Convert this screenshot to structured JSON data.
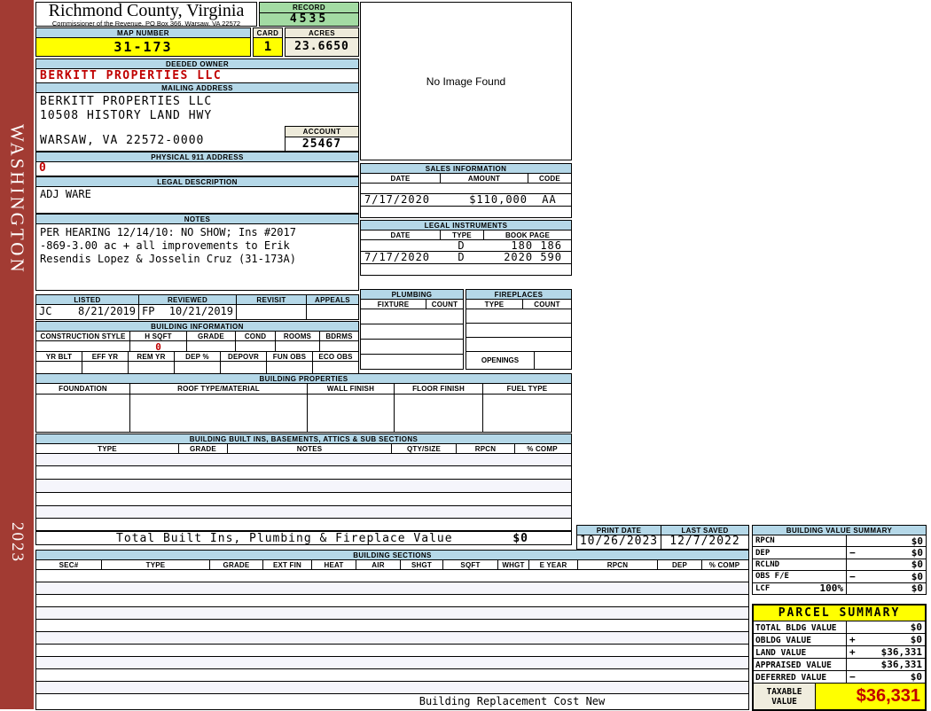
{
  "county": {
    "title": "Richmond County, Virginia",
    "subtitle": "Commissioner of the Revenue, PO Box 366, Warsaw, VA 22572"
  },
  "sidebar": {
    "district": "WASHINGTON",
    "year": "2023"
  },
  "record": {
    "label": "RECORD",
    "value": "4535"
  },
  "map": {
    "label": "MAP NUMBER",
    "value": "31-173"
  },
  "card": {
    "label": "CARD",
    "value": "1"
  },
  "acres": {
    "label": "ACRES",
    "value": "23.6650"
  },
  "deeded_owner": {
    "label": "DEEDED OWNER",
    "value": "BERKITT PROPERTIES LLC"
  },
  "mailing": {
    "label": "MAILING ADDRESS",
    "line1": "BERKITT PROPERTIES LLC",
    "line2": "10508 HISTORY LAND HWY",
    "line3": "WARSAW, VA 22572-0000"
  },
  "account": {
    "label": "ACCOUNT",
    "value": "25467"
  },
  "physical": {
    "label": "PHYSICAL 911 ADDRESS",
    "value": "0"
  },
  "legal_description": {
    "label": "LEGAL DESCRIPTION",
    "value": "ADJ WARE"
  },
  "notes": {
    "label": "NOTES",
    "line1": "PER HEARING 12/14/10: NO SHOW; Ins #2017",
    "line2": "-869-3.00 ac + all improvements to Erik",
    "line3": "Resendis Lopez & Josselin Cruz (31-173A)"
  },
  "image_box": {
    "text": "No Image Found"
  },
  "review": {
    "headers": [
      "LISTED",
      "REVIEWED",
      "REVISIT",
      "APPEALS"
    ],
    "listed_by": "JC",
    "listed_date": "8/21/2019",
    "reviewed_by": "FP",
    "reviewed_date": "10/21/2019"
  },
  "building_information": {
    "title": "BUILDING INFORMATION",
    "row1_headers": [
      "CONSTRUCTION STYLE",
      "H SQFT",
      "GRADE",
      "COND",
      "ROOMS",
      "BDRMS"
    ],
    "h_sqft_value": "0",
    "row2_headers": [
      "YR BLT",
      "EFF YR",
      "REM YR",
      "DEP %",
      "DEPOVR",
      "FUN OBS",
      "ECO OBS"
    ]
  },
  "sales_information": {
    "title": "SALES INFORMATION",
    "headers": [
      "DATE",
      "AMOUNT",
      "CODE"
    ],
    "rows": [
      [
        "",
        "",
        ""
      ],
      [
        "7/17/2020",
        "$110,000",
        "AA"
      ],
      [
        "",
        "",
        ""
      ]
    ]
  },
  "legal_instruments": {
    "title": "LEGAL INSTRUMENTS",
    "headers": [
      "DATE",
      "TYPE",
      "BOOK PAGE"
    ],
    "rows": [
      [
        "",
        "D",
        "180 186"
      ],
      [
        "7/17/2020",
        "D",
        "2020 590"
      ],
      [
        "",
        "",
        ""
      ]
    ]
  },
  "plumbing": {
    "title": "PLUMBING",
    "headers": [
      "FIXTURE",
      "COUNT"
    ]
  },
  "fireplaces": {
    "title": "FIREPLACES",
    "headers": [
      "TYPE",
      "COUNT"
    ],
    "openings_label": "OPENINGS"
  },
  "building_properties": {
    "title": "BUILDING PROPERTIES",
    "headers": [
      "FOUNDATION",
      "ROOF TYPE/MATERIAL",
      "WALL FINISH",
      "FLOOR FINISH",
      "FUEL TYPE"
    ]
  },
  "built_ins": {
    "title": "BUILDING BUILT INS, BASEMENTS, ATTICS & SUB SECTIONS",
    "headers": [
      "TYPE",
      "GRADE",
      "NOTES",
      "QTY/SIZE",
      "RPCN",
      "% COMP"
    ],
    "total_label": "Total Built Ins, Plumbing & Fireplace Value",
    "total_value": "$0"
  },
  "print_info": {
    "print_date_label": "PRINT DATE",
    "print_date": "10/26/2023",
    "last_saved_label": "LAST SAVED",
    "last_saved": "12/7/2022"
  },
  "building_value_summary": {
    "title": "BUILDING VALUE SUMMARY",
    "rows": [
      {
        "label": "RPCN",
        "sub": "",
        "op": "",
        "value": "$0"
      },
      {
        "label": "DEP",
        "sub": "",
        "op": "−",
        "value": "$0"
      },
      {
        "label": "RCLND",
        "sub": "",
        "op": "",
        "value": "$0"
      },
      {
        "label": "OBS F/E",
        "sub": "",
        "op": "−",
        "value": "$0"
      },
      {
        "label": "LCF",
        "sub": "100%",
        "op": "",
        "value": "$0"
      }
    ]
  },
  "building_sections": {
    "title": "BUILDING SECTIONS",
    "headers": [
      "SEC#",
      "TYPE",
      "GRADE",
      "EXT FIN",
      "HEAT",
      "AIR",
      "SHGT",
      "SQFT",
      "WHGT",
      "E YEAR",
      "RPCN",
      "DEP",
      "% COMP"
    ],
    "footer": "Building Replacement Cost New"
  },
  "parcel_summary": {
    "title": "PARCEL SUMMARY",
    "rows": [
      {
        "label": "TOTAL BLDG VALUE",
        "op": "",
        "value": "$0"
      },
      {
        "label": "OBLDG VALUE",
        "op": "+",
        "value": "$0"
      },
      {
        "label": "LAND VALUE",
        "op": "+",
        "value": "$36,331"
      },
      {
        "label": "APPRAISED VALUE",
        "op": "",
        "value": "$36,331"
      },
      {
        "label": "DEFERRED VALUE",
        "op": "−",
        "value": "$0"
      }
    ],
    "taxable_label_line1": "TAXABLE",
    "taxable_label_line2": "VALUE",
    "taxable_value": "$36,331"
  },
  "colors": {
    "header_blue": "#B5D8E8",
    "record_green": "#A3DBA3",
    "highlight_yellow": "#FFFF00",
    "beige": "#EDEADA",
    "sidebar_red": "#A23B33",
    "value_red": "#C00000"
  }
}
